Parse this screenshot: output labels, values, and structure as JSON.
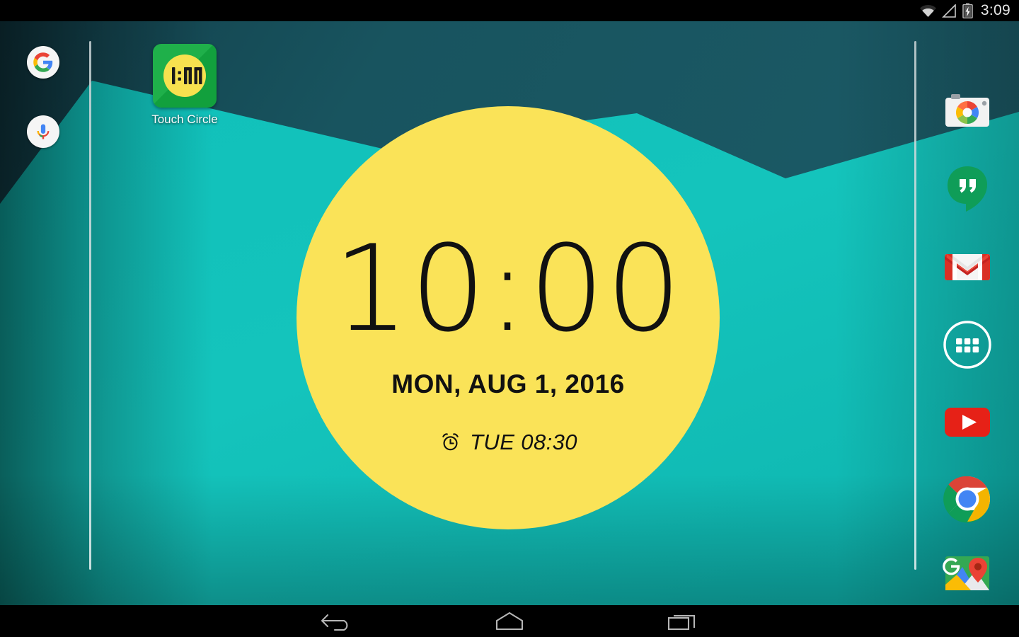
{
  "status_bar": {
    "clock": "3:09",
    "icons": [
      "wifi-icon",
      "cell-signal-icon",
      "battery-charging-icon"
    ]
  },
  "wallpaper": {
    "name": "material-mountains-wallpaper",
    "color_dark_teal": "#18545f",
    "color_bright_teal": "#14c4bc",
    "color_edge_shadow": "#0d2f38"
  },
  "page_indicator": {
    "left_line": "page-indicator-left",
    "right_line": "page-indicator-right",
    "color": "#dfe9ea"
  },
  "search": {
    "google_label": "G",
    "google_icon": "google-logo-icon",
    "voice_icon": "google-mic-icon"
  },
  "shortcuts": [
    {
      "label": "Touch Circle",
      "icon": "touch-circle-app-icon",
      "icon_text": "1:00",
      "icon_bg": "#1fb04a",
      "icon_circle": "#f7e14f"
    }
  ],
  "clock_widget": {
    "name": "touch-circle-clock-widget",
    "time": "10:00",
    "date": "MON, AUG 1, 2016",
    "alarm": "TUE 08:30",
    "alarm_icon": "alarm-clock-icon",
    "circle_color": "#fae358",
    "text_color": "#111111"
  },
  "dock": {
    "items": [
      {
        "name": "camera",
        "label": "Camera",
        "icon": "google-camera-icon"
      },
      {
        "name": "hangouts",
        "label": "Hangouts",
        "icon": "hangouts-icon"
      },
      {
        "name": "gmail",
        "label": "Gmail",
        "icon": "gmail-icon"
      },
      {
        "name": "app-drawer",
        "label": "Apps",
        "icon": "app-drawer-icon"
      },
      {
        "name": "youtube",
        "label": "YouTube",
        "icon": "youtube-icon"
      },
      {
        "name": "chrome",
        "label": "Chrome",
        "icon": "chrome-icon"
      },
      {
        "name": "maps",
        "label": "Maps",
        "icon": "google-maps-icon"
      }
    ]
  },
  "nav_bar": {
    "back": "back-button",
    "home": "home-button",
    "recents": "recents-button",
    "color": "#b6b6b6"
  }
}
